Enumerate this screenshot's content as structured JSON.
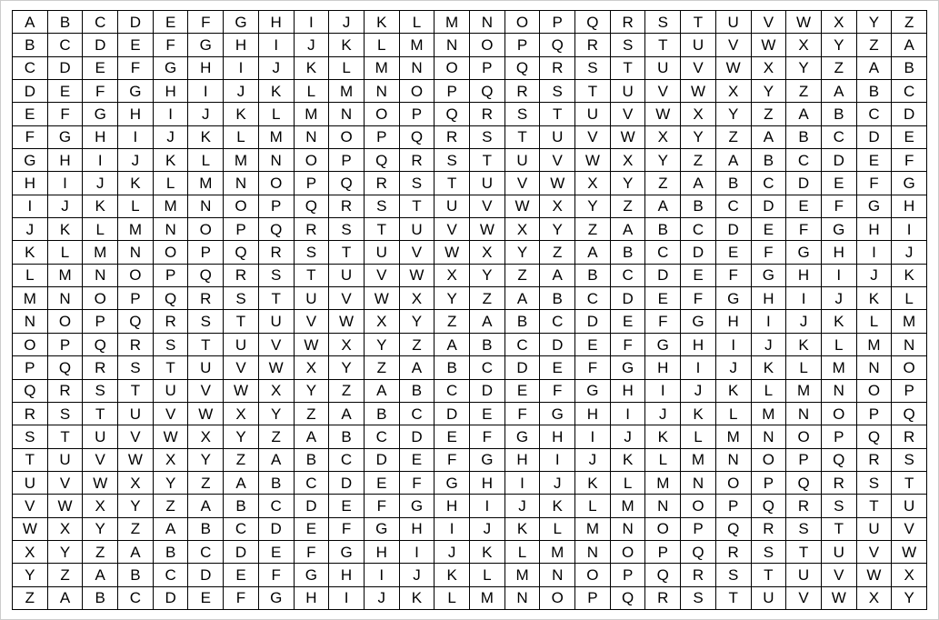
{
  "tabula_recta": {
    "rows": 26,
    "cols": 26,
    "alphabet": [
      "A",
      "B",
      "C",
      "D",
      "E",
      "F",
      "G",
      "H",
      "I",
      "J",
      "K",
      "L",
      "M",
      "N",
      "O",
      "P",
      "Q",
      "R",
      "S",
      "T",
      "U",
      "V",
      "W",
      "X",
      "Y",
      "Z"
    ],
    "grid": [
      [
        "A",
        "B",
        "C",
        "D",
        "E",
        "F",
        "G",
        "H",
        "I",
        "J",
        "K",
        "L",
        "M",
        "N",
        "O",
        "P",
        "Q",
        "R",
        "S",
        "T",
        "U",
        "V",
        "W",
        "X",
        "Y",
        "Z"
      ],
      [
        "B",
        "C",
        "D",
        "E",
        "F",
        "G",
        "H",
        "I",
        "J",
        "K",
        "L",
        "M",
        "N",
        "O",
        "P",
        "Q",
        "R",
        "S",
        "T",
        "U",
        "V",
        "W",
        "X",
        "Y",
        "Z",
        "A"
      ],
      [
        "C",
        "D",
        "E",
        "F",
        "G",
        "H",
        "I",
        "J",
        "K",
        "L",
        "M",
        "N",
        "O",
        "P",
        "Q",
        "R",
        "S",
        "T",
        "U",
        "V",
        "W",
        "X",
        "Y",
        "Z",
        "A",
        "B"
      ],
      [
        "D",
        "E",
        "F",
        "G",
        "H",
        "I",
        "J",
        "K",
        "L",
        "M",
        "N",
        "O",
        "P",
        "Q",
        "R",
        "S",
        "T",
        "U",
        "V",
        "W",
        "X",
        "Y",
        "Z",
        "A",
        "B",
        "C"
      ],
      [
        "E",
        "F",
        "G",
        "H",
        "I",
        "J",
        "K",
        "L",
        "M",
        "N",
        "O",
        "P",
        "Q",
        "R",
        "S",
        "T",
        "U",
        "V",
        "W",
        "X",
        "Y",
        "Z",
        "A",
        "B",
        "C",
        "D"
      ],
      [
        "F",
        "G",
        "H",
        "I",
        "J",
        "K",
        "L",
        "M",
        "N",
        "O",
        "P",
        "Q",
        "R",
        "S",
        "T",
        "U",
        "V",
        "W",
        "X",
        "Y",
        "Z",
        "A",
        "B",
        "C",
        "D",
        "E"
      ],
      [
        "G",
        "H",
        "I",
        "J",
        "K",
        "L",
        "M",
        "N",
        "O",
        "P",
        "Q",
        "R",
        "S",
        "T",
        "U",
        "V",
        "W",
        "X",
        "Y",
        "Z",
        "A",
        "B",
        "C",
        "D",
        "E",
        "F"
      ],
      [
        "H",
        "I",
        "J",
        "K",
        "L",
        "M",
        "N",
        "O",
        "P",
        "Q",
        "R",
        "S",
        "T",
        "U",
        "V",
        "W",
        "X",
        "Y",
        "Z",
        "A",
        "B",
        "C",
        "D",
        "E",
        "F",
        "G"
      ],
      [
        "I",
        "J",
        "K",
        "L",
        "M",
        "N",
        "O",
        "P",
        "Q",
        "R",
        "S",
        "T",
        "U",
        "V",
        "W",
        "X",
        "Y",
        "Z",
        "A",
        "B",
        "C",
        "D",
        "E",
        "F",
        "G",
        "H"
      ],
      [
        "J",
        "K",
        "L",
        "M",
        "N",
        "O",
        "P",
        "Q",
        "R",
        "S",
        "T",
        "U",
        "V",
        "W",
        "X",
        "Y",
        "Z",
        "A",
        "B",
        "C",
        "D",
        "E",
        "F",
        "G",
        "H",
        "I"
      ],
      [
        "K",
        "L",
        "M",
        "N",
        "O",
        "P",
        "Q",
        "R",
        "S",
        "T",
        "U",
        "V",
        "W",
        "X",
        "Y",
        "Z",
        "A",
        "B",
        "C",
        "D",
        "E",
        "F",
        "G",
        "H",
        "I",
        "J"
      ],
      [
        "L",
        "M",
        "N",
        "O",
        "P",
        "Q",
        "R",
        "S",
        "T",
        "U",
        "V",
        "W",
        "X",
        "Y",
        "Z",
        "A",
        "B",
        "C",
        "D",
        "E",
        "F",
        "G",
        "H",
        "I",
        "J",
        "K"
      ],
      [
        "M",
        "N",
        "O",
        "P",
        "Q",
        "R",
        "S",
        "T",
        "U",
        "V",
        "W",
        "X",
        "Y",
        "Z",
        "A",
        "B",
        "C",
        "D",
        "E",
        "F",
        "G",
        "H",
        "I",
        "J",
        "K",
        "L"
      ],
      [
        "N",
        "O",
        "P",
        "Q",
        "R",
        "S",
        "T",
        "U",
        "V",
        "W",
        "X",
        "Y",
        "Z",
        "A",
        "B",
        "C",
        "D",
        "E",
        "F",
        "G",
        "H",
        "I",
        "J",
        "K",
        "L",
        "M"
      ],
      [
        "O",
        "P",
        "Q",
        "R",
        "S",
        "T",
        "U",
        "V",
        "W",
        "X",
        "Y",
        "Z",
        "A",
        "B",
        "C",
        "D",
        "E",
        "F",
        "G",
        "H",
        "I",
        "J",
        "K",
        "L",
        "M",
        "N"
      ],
      [
        "P",
        "Q",
        "R",
        "S",
        "T",
        "U",
        "V",
        "W",
        "X",
        "Y",
        "Z",
        "A",
        "B",
        "C",
        "D",
        "E",
        "F",
        "G",
        "H",
        "I",
        "J",
        "K",
        "L",
        "M",
        "N",
        "O"
      ],
      [
        "Q",
        "R",
        "S",
        "T",
        "U",
        "V",
        "W",
        "X",
        "Y",
        "Z",
        "A",
        "B",
        "C",
        "D",
        "E",
        "F",
        "G",
        "H",
        "I",
        "J",
        "K",
        "L",
        "M",
        "N",
        "O",
        "P"
      ],
      [
        "R",
        "S",
        "T",
        "U",
        "V",
        "W",
        "X",
        "Y",
        "Z",
        "A",
        "B",
        "C",
        "D",
        "E",
        "F",
        "G",
        "H",
        "I",
        "J",
        "K",
        "L",
        "M",
        "N",
        "O",
        "P",
        "Q"
      ],
      [
        "S",
        "T",
        "U",
        "V",
        "W",
        "X",
        "Y",
        "Z",
        "A",
        "B",
        "C",
        "D",
        "E",
        "F",
        "G",
        "H",
        "I",
        "J",
        "K",
        "L",
        "M",
        "N",
        "O",
        "P",
        "Q",
        "R"
      ],
      [
        "T",
        "U",
        "V",
        "W",
        "X",
        "Y",
        "Z",
        "A",
        "B",
        "C",
        "D",
        "E",
        "F",
        "G",
        "H",
        "I",
        "J",
        "K",
        "L",
        "M",
        "N",
        "O",
        "P",
        "Q",
        "R",
        "S"
      ],
      [
        "U",
        "V",
        "W",
        "X",
        "Y",
        "Z",
        "A",
        "B",
        "C",
        "D",
        "E",
        "F",
        "G",
        "H",
        "I",
        "J",
        "K",
        "L",
        "M",
        "N",
        "O",
        "P",
        "Q",
        "R",
        "S",
        "T"
      ],
      [
        "V",
        "W",
        "X",
        "Y",
        "Z",
        "A",
        "B",
        "C",
        "D",
        "E",
        "F",
        "G",
        "H",
        "I",
        "J",
        "K",
        "L",
        "M",
        "N",
        "O",
        "P",
        "Q",
        "R",
        "S",
        "T",
        "U"
      ],
      [
        "W",
        "X",
        "Y",
        "Z",
        "A",
        "B",
        "C",
        "D",
        "E",
        "F",
        "G",
        "H",
        "I",
        "J",
        "K",
        "L",
        "M",
        "N",
        "O",
        "P",
        "Q",
        "R",
        "S",
        "T",
        "U",
        "V"
      ],
      [
        "X",
        "Y",
        "Z",
        "A",
        "B",
        "C",
        "D",
        "E",
        "F",
        "G",
        "H",
        "I",
        "J",
        "K",
        "L",
        "M",
        "N",
        "O",
        "P",
        "Q",
        "R",
        "S",
        "T",
        "U",
        "V",
        "W"
      ],
      [
        "Y",
        "Z",
        "A",
        "B",
        "C",
        "D",
        "E",
        "F",
        "G",
        "H",
        "I",
        "J",
        "K",
        "L",
        "M",
        "N",
        "O",
        "P",
        "Q",
        "R",
        "S",
        "T",
        "U",
        "V",
        "W",
        "X"
      ],
      [
        "Z",
        "A",
        "B",
        "C",
        "D",
        "E",
        "F",
        "G",
        "H",
        "I",
        "J",
        "K",
        "L",
        "M",
        "N",
        "O",
        "P",
        "Q",
        "R",
        "S",
        "T",
        "U",
        "V",
        "W",
        "X",
        "Y"
      ]
    ]
  }
}
